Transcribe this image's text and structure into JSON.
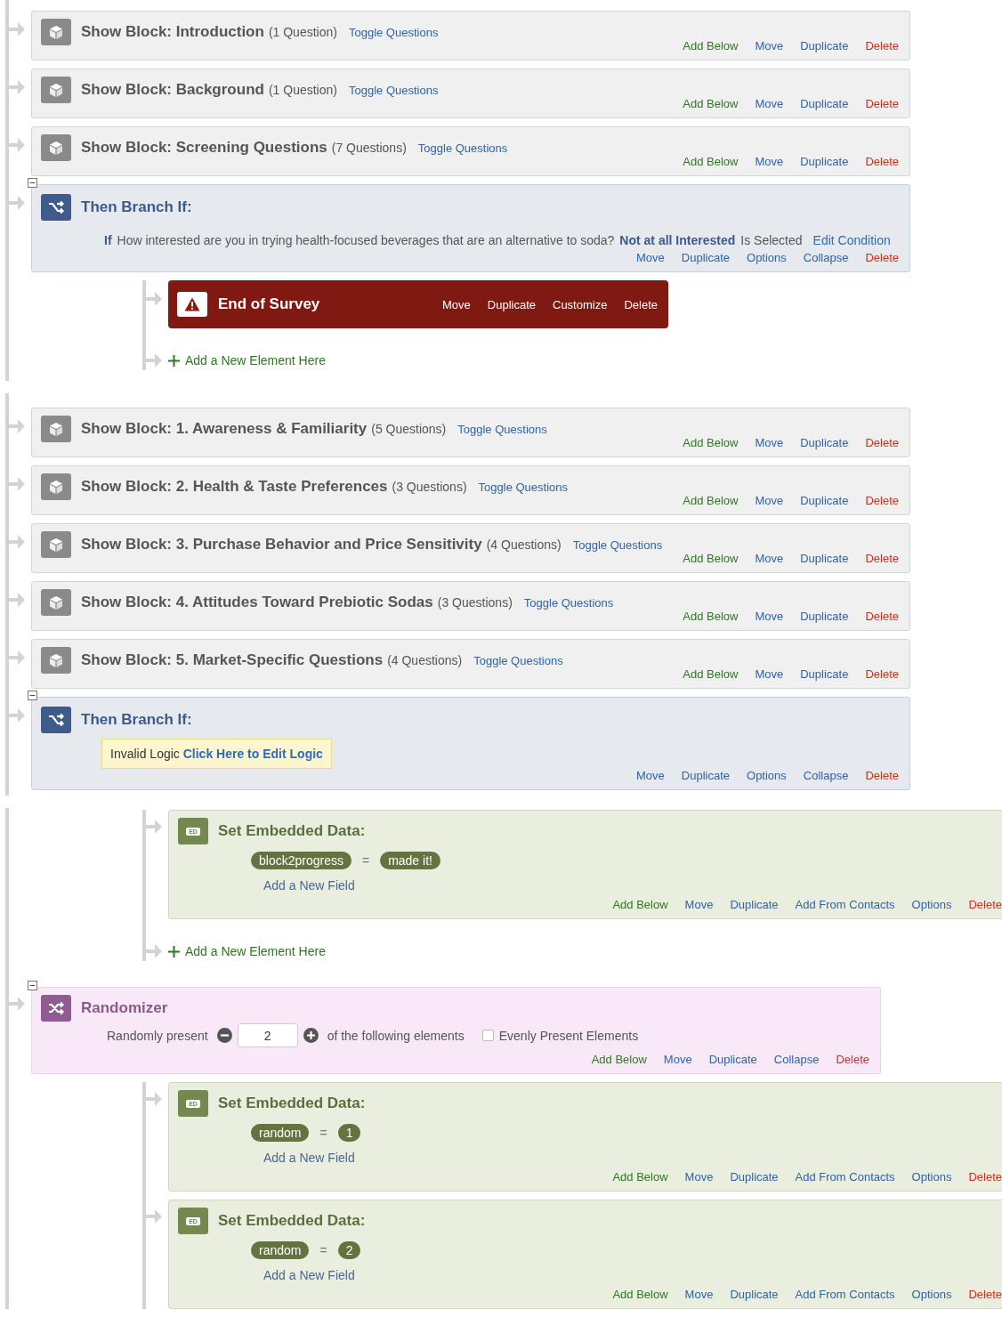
{
  "panels": [
    {
      "elements": [
        {
          "kind": "block",
          "title": "Show Block: Introduction",
          "count": "(1 Question)",
          "toggle": "Toggle Questions",
          "actions": [
            {
              "label": "Add Below",
              "kind": "add"
            },
            {
              "label": "Move",
              "kind": "link"
            },
            {
              "label": "Duplicate",
              "kind": "link"
            },
            {
              "label": "Delete",
              "kind": "delete"
            }
          ]
        },
        {
          "kind": "block",
          "title": "Show Block: Background",
          "count": "(1 Question)",
          "toggle": "Toggle Questions",
          "actions": [
            {
              "label": "Add Below",
              "kind": "add"
            },
            {
              "label": "Move",
              "kind": "link"
            },
            {
              "label": "Duplicate",
              "kind": "link"
            },
            {
              "label": "Delete",
              "kind": "delete"
            }
          ]
        },
        {
          "kind": "block",
          "title": "Show Block: Screening Questions",
          "count": "(7 Questions)",
          "toggle": "Toggle Questions",
          "actions": [
            {
              "label": "Add Below",
              "kind": "add"
            },
            {
              "label": "Move",
              "kind": "link"
            },
            {
              "label": "Duplicate",
              "kind": "link"
            },
            {
              "label": "Delete",
              "kind": "delete"
            }
          ]
        },
        {
          "kind": "branch",
          "title": "Then Branch If:",
          "condition": {
            "kind": "rule",
            "if": "If",
            "question": "How interested are you in trying health-focused beverages that are an alternative to soda?",
            "answer": "Not at all Interested",
            "operator": "Is Selected",
            "edit": "Edit Condition"
          },
          "actions": [
            {
              "label": "Move",
              "kind": "link"
            },
            {
              "label": "Duplicate",
              "kind": "link"
            },
            {
              "label": "Options",
              "kind": "link"
            },
            {
              "label": "Collapse",
              "kind": "link"
            },
            {
              "label": "Delete",
              "kind": "delete"
            }
          ],
          "children": [
            {
              "kind": "end",
              "title": "End of Survey",
              "actions": [
                {
                  "label": "Move",
                  "kind": "light"
                },
                {
                  "label": "Duplicate",
                  "kind": "light"
                },
                {
                  "label": "Customize",
                  "kind": "light"
                },
                {
                  "label": "Delete",
                  "kind": "light"
                }
              ]
            },
            {
              "kind": "add",
              "label": "Add a New Element Here"
            }
          ]
        }
      ]
    },
    {
      "elements": [
        {
          "kind": "block",
          "title": "Show Block: 1. Awareness & Familiarity",
          "count": "(5 Questions)",
          "toggle": "Toggle Questions",
          "actions": [
            {
              "label": "Add Below",
              "kind": "add"
            },
            {
              "label": "Move",
              "kind": "link"
            },
            {
              "label": "Duplicate",
              "kind": "link"
            },
            {
              "label": "Delete",
              "kind": "delete"
            }
          ]
        },
        {
          "kind": "block",
          "title": "Show Block: 2. Health & Taste Preferences",
          "count": "(3 Questions)",
          "toggle": "Toggle Questions",
          "actions": [
            {
              "label": "Add Below",
              "kind": "add"
            },
            {
              "label": "Move",
              "kind": "link"
            },
            {
              "label": "Duplicate",
              "kind": "link"
            },
            {
              "label": "Delete",
              "kind": "delete"
            }
          ]
        },
        {
          "kind": "block",
          "title": "Show Block: 3. Purchase Behavior and Price Sensitivity",
          "count": "(4 Questions)",
          "toggle": "Toggle Questions",
          "actions": [
            {
              "label": "Add Below",
              "kind": "add"
            },
            {
              "label": "Move",
              "kind": "link"
            },
            {
              "label": "Duplicate",
              "kind": "link"
            },
            {
              "label": "Delete",
              "kind": "delete"
            }
          ]
        },
        {
          "kind": "block",
          "title": "Show Block: 4. Attitudes Toward Prebiotic Sodas",
          "count": "(3 Questions)",
          "toggle": "Toggle Questions",
          "actions": [
            {
              "label": "Add Below",
              "kind": "add"
            },
            {
              "label": "Move",
              "kind": "link"
            },
            {
              "label": "Duplicate",
              "kind": "link"
            },
            {
              "label": "Delete",
              "kind": "delete"
            }
          ]
        },
        {
          "kind": "block",
          "title": "Show Block: 5. Market-Specific Questions",
          "count": "(4 Questions)",
          "toggle": "Toggle Questions",
          "actions": [
            {
              "label": "Add Below",
              "kind": "add"
            },
            {
              "label": "Move",
              "kind": "link"
            },
            {
              "label": "Duplicate",
              "kind": "link"
            },
            {
              "label": "Delete",
              "kind": "delete"
            }
          ]
        },
        {
          "kind": "branch",
          "title": "Then Branch If:",
          "condition": {
            "kind": "invalid",
            "text": "Invalid Logic",
            "link": "Click Here to Edit Logic"
          },
          "actions": [
            {
              "label": "Move",
              "kind": "link"
            },
            {
              "label": "Duplicate",
              "kind": "link"
            },
            {
              "label": "Options",
              "kind": "link"
            },
            {
              "label": "Collapse",
              "kind": "link"
            },
            {
              "label": "Delete",
              "kind": "delete"
            }
          ]
        }
      ]
    },
    {
      "elements": [
        {
          "kind": "group",
          "children": [
            {
              "kind": "embedded",
              "icon_label": "ED",
              "title": "Set Embedded Data:",
              "fields": [
                {
                  "name": "block2progress",
                  "operator": "=",
                  "value": "made it!"
                }
              ],
              "add_field": "Add a New Field",
              "actions": [
                {
                  "label": "Add Below",
                  "kind": "add"
                },
                {
                  "label": "Move",
                  "kind": "link"
                },
                {
                  "label": "Duplicate",
                  "kind": "link"
                },
                {
                  "label": "Add From Contacts",
                  "kind": "link"
                },
                {
                  "label": "Options",
                  "kind": "link"
                },
                {
                  "label": "Delete",
                  "kind": "delete"
                }
              ]
            },
            {
              "kind": "add",
              "label": "Add a New Element Here"
            }
          ]
        },
        {
          "kind": "randomizer",
          "title": "Randomizer",
          "prefix": "Randomly present",
          "count": "2",
          "suffix": "of the following elements",
          "evenly": {
            "label": "Evenly Present Elements",
            "checked": false
          },
          "actions": [
            {
              "label": "Add Below",
              "kind": "add"
            },
            {
              "label": "Move",
              "kind": "link"
            },
            {
              "label": "Duplicate",
              "kind": "link"
            },
            {
              "label": "Collapse",
              "kind": "link"
            },
            {
              "label": "Delete",
              "kind": "delete"
            }
          ],
          "children": [
            {
              "kind": "embedded",
              "icon_label": "ED",
              "title": "Set Embedded Data:",
              "fields": [
                {
                  "name": "random",
                  "operator": "=",
                  "value": "1"
                }
              ],
              "add_field": "Add a New Field",
              "actions": [
                {
                  "label": "Add Below",
                  "kind": "add"
                },
                {
                  "label": "Move",
                  "kind": "link"
                },
                {
                  "label": "Duplicate",
                  "kind": "link"
                },
                {
                  "label": "Add From Contacts",
                  "kind": "link"
                },
                {
                  "label": "Options",
                  "kind": "link"
                },
                {
                  "label": "Delete",
                  "kind": "delete"
                }
              ]
            },
            {
              "kind": "embedded",
              "icon_label": "ED",
              "title": "Set Embedded Data:",
              "fields": [
                {
                  "name": "random",
                  "operator": "=",
                  "value": "2"
                }
              ],
              "add_field": "Add a New Field",
              "actions": [
                {
                  "label": "Add Below",
                  "kind": "add"
                },
                {
                  "label": "Move",
                  "kind": "link"
                },
                {
                  "label": "Duplicate",
                  "kind": "link"
                },
                {
                  "label": "Add From Contacts",
                  "kind": "link"
                },
                {
                  "label": "Options",
                  "kind": "link"
                },
                {
                  "label": "Delete",
                  "kind": "delete"
                }
              ]
            }
          ]
        }
      ]
    }
  ]
}
